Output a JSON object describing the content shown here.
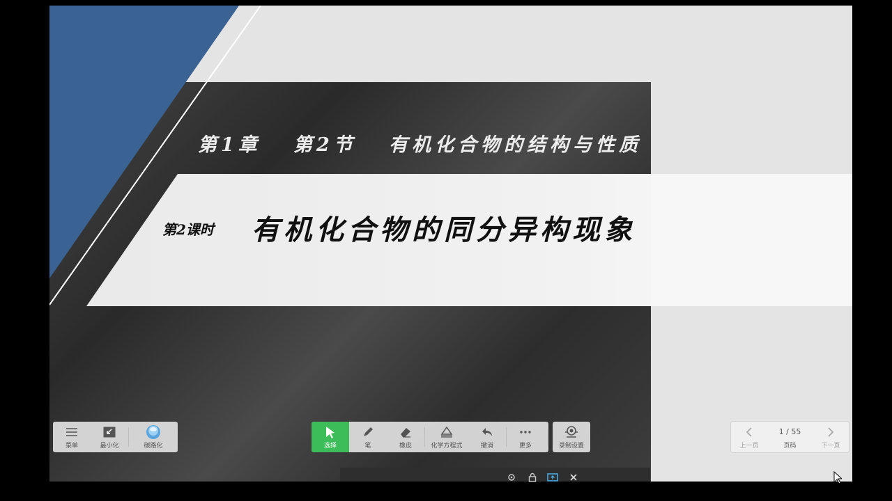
{
  "slide": {
    "title": "第1章   第2节   有机化合物的结构与性质",
    "lesson_label": "第2课时",
    "heading": "有机化合物的同分异构现象"
  },
  "left_toolbar": {
    "menu_label": "菜单",
    "minimize_label": "最小化",
    "reduce_label": "碳路化"
  },
  "center_toolbar": {
    "select_label": "选择",
    "pen_label": "笔",
    "eraser_label": "橡皮",
    "formula_label": "化学方程式",
    "undo_label": "撤消",
    "more_label": "更多"
  },
  "record_toolbar": {
    "record_label": "录制设置"
  },
  "page_nav": {
    "prev_label": "上一页",
    "page_indicator": "1 / 55",
    "page_label": "页码",
    "next_label": "下一页"
  },
  "colors": {
    "accent_green": "#3dbd59",
    "slide_blue": "#3a6394"
  },
  "icons": [
    "menu-icon",
    "minimize-icon",
    "blue-ball-icon",
    "cursor-icon",
    "pen-icon",
    "eraser-icon",
    "formula-icon",
    "undo-icon",
    "more-icon",
    "record-icon",
    "chevron-left-icon",
    "chevron-right-icon",
    "settings-icon",
    "lock-icon",
    "screen-icon",
    "close-icon"
  ]
}
